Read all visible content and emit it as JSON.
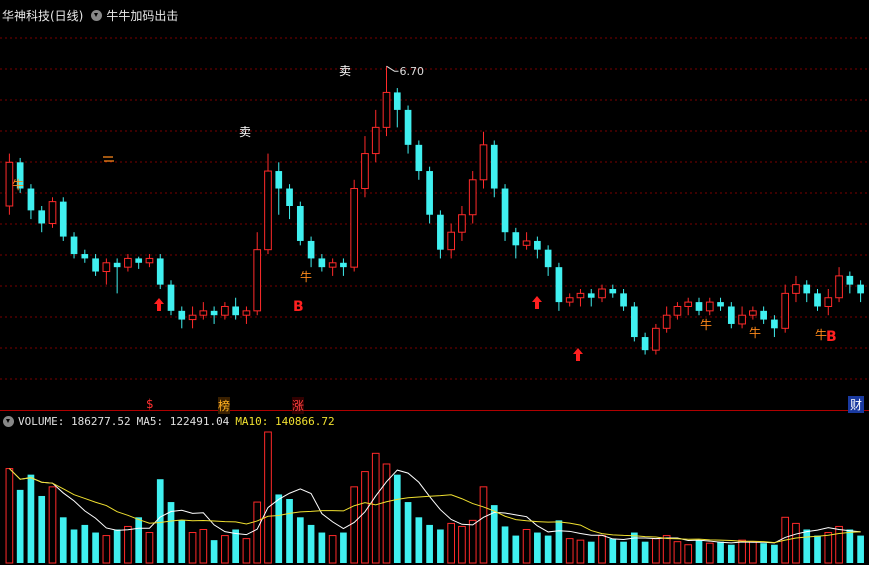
{
  "window": {
    "stock_name": "华神科技(日线)",
    "indicator_name": "牛牛加码出击"
  },
  "colors": {
    "up": "#ff2a2a",
    "down": "#40f0f0",
    "ma5": "#ffffff",
    "ma10": "#f0e030",
    "grid": "#7a0000",
    "background": "#000000",
    "buy_marker": "#ff2020"
  },
  "price_annotations": {
    "peak_value": "6.70",
    "sell_labels": [
      "卖",
      "卖"
    ],
    "bull_labels": [
      "牛",
      "牛",
      "牛",
      "牛",
      "牛"
    ],
    "buy_labels": [
      "B",
      "B"
    ],
    "arrow_up_icon": "up-arrow-icon"
  },
  "event_markers": {
    "dollar": "$",
    "board": "榜",
    "rise": "涨",
    "finance": "财"
  },
  "volume_panel": {
    "volume_label": "VOLUME: 186277.52",
    "ma5_label": "MA5: 122491.04",
    "ma10_label": "MA10: 140866.72"
  },
  "chart_data": {
    "type": "candlestick",
    "note_series": [
      {
        "name": "price",
        "ohlc": [
          [
            5.1,
            5.6,
            5.7,
            5.0
          ],
          [
            5.6,
            5.3,
            5.65,
            5.25
          ],
          [
            5.3,
            5.05,
            5.35,
            4.95
          ],
          [
            5.05,
            4.9,
            5.1,
            4.8
          ],
          [
            4.9,
            5.15,
            5.2,
            4.85
          ],
          [
            5.15,
            4.75,
            5.2,
            4.7
          ],
          [
            4.75,
            4.55,
            4.8,
            4.5
          ],
          [
            4.55,
            4.5,
            4.6,
            4.45
          ],
          [
            4.5,
            4.35,
            4.55,
            4.3
          ],
          [
            4.35,
            4.45,
            4.5,
            4.2
          ],
          [
            4.45,
            4.4,
            4.5,
            4.1
          ],
          [
            4.4,
            4.5,
            4.55,
            4.35
          ],
          [
            4.5,
            4.45,
            4.52,
            4.38
          ],
          [
            4.45,
            4.5,
            4.55,
            4.4
          ],
          [
            4.5,
            4.2,
            4.55,
            4.15
          ],
          [
            4.2,
            3.9,
            4.25,
            3.85
          ],
          [
            3.9,
            3.8,
            3.95,
            3.7
          ],
          [
            3.8,
            3.85,
            3.95,
            3.7
          ],
          [
            3.85,
            3.9,
            4.0,
            3.8
          ],
          [
            3.9,
            3.85,
            3.95,
            3.75
          ],
          [
            3.85,
            3.95,
            4.0,
            3.8
          ],
          [
            3.95,
            3.85,
            4.05,
            3.8
          ],
          [
            3.85,
            3.9,
            3.95,
            3.75
          ],
          [
            3.9,
            4.6,
            4.8,
            3.85
          ],
          [
            4.6,
            5.5,
            5.7,
            4.55
          ],
          [
            5.5,
            5.3,
            5.6,
            5.0
          ],
          [
            5.3,
            5.1,
            5.35,
            4.95
          ],
          [
            5.1,
            4.7,
            5.15,
            4.65
          ],
          [
            4.7,
            4.5,
            4.75,
            4.4
          ],
          [
            4.5,
            4.4,
            4.55,
            4.35
          ],
          [
            4.4,
            4.45,
            4.5,
            4.3
          ],
          [
            4.45,
            4.4,
            4.5,
            4.3
          ],
          [
            4.4,
            5.3,
            5.4,
            4.35
          ],
          [
            5.3,
            5.7,
            5.9,
            5.2
          ],
          [
            5.7,
            6.0,
            6.2,
            5.6
          ],
          [
            6.0,
            6.4,
            6.7,
            5.9
          ],
          [
            6.4,
            6.2,
            6.45,
            6.0
          ],
          [
            6.2,
            5.8,
            6.25,
            5.7
          ],
          [
            5.8,
            5.5,
            5.85,
            5.4
          ],
          [
            5.5,
            5.0,
            5.55,
            4.9
          ],
          [
            5.0,
            4.6,
            5.05,
            4.5
          ],
          [
            4.6,
            4.8,
            4.9,
            4.5
          ],
          [
            4.8,
            5.0,
            5.1,
            4.7
          ],
          [
            5.0,
            5.4,
            5.5,
            4.9
          ],
          [
            5.4,
            5.8,
            5.95,
            5.3
          ],
          [
            5.8,
            5.3,
            5.85,
            5.2
          ],
          [
            5.3,
            4.8,
            5.35,
            4.7
          ],
          [
            4.8,
            4.65,
            4.85,
            4.5
          ],
          [
            4.65,
            4.7,
            4.8,
            4.6
          ],
          [
            4.7,
            4.6,
            4.75,
            4.5
          ],
          [
            4.6,
            4.4,
            4.65,
            4.3
          ],
          [
            4.4,
            4.0,
            4.45,
            3.9
          ],
          [
            4.0,
            4.05,
            4.1,
            3.95
          ],
          [
            4.05,
            4.1,
            4.15,
            3.95
          ],
          [
            4.1,
            4.05,
            4.15,
            3.95
          ],
          [
            4.05,
            4.15,
            4.2,
            4.0
          ],
          [
            4.15,
            4.1,
            4.2,
            4.05
          ],
          [
            4.1,
            3.95,
            4.15,
            3.9
          ],
          [
            3.95,
            3.6,
            4.0,
            3.55
          ],
          [
            3.6,
            3.45,
            3.65,
            3.4
          ],
          [
            3.45,
            3.7,
            3.75,
            3.4
          ],
          [
            3.7,
            3.85,
            3.95,
            3.65
          ],
          [
            3.85,
            3.95,
            4.0,
            3.8
          ],
          [
            3.95,
            4.0,
            4.05,
            3.85
          ],
          [
            4.0,
            3.9,
            4.05,
            3.85
          ],
          [
            3.9,
            4.0,
            4.05,
            3.85
          ],
          [
            4.0,
            3.95,
            4.05,
            3.9
          ],
          [
            3.95,
            3.75,
            4.0,
            3.7
          ],
          [
            3.75,
            3.85,
            3.95,
            3.7
          ],
          [
            3.85,
            3.9,
            3.95,
            3.8
          ],
          [
            3.9,
            3.8,
            3.95,
            3.75
          ],
          [
            3.8,
            3.7,
            3.85,
            3.6
          ],
          [
            3.7,
            4.1,
            4.2,
            3.65
          ],
          [
            4.1,
            4.2,
            4.3,
            4.0
          ],
          [
            4.2,
            4.1,
            4.25,
            4.0
          ],
          [
            4.1,
            3.95,
            4.15,
            3.9
          ],
          [
            3.95,
            4.05,
            4.15,
            3.85
          ],
          [
            4.05,
            4.3,
            4.4,
            4.0
          ],
          [
            4.3,
            4.2,
            4.35,
            4.1
          ],
          [
            4.2,
            4.1,
            4.25,
            4.0
          ]
        ],
        "volume": [
          62,
          48,
          58,
          44,
          50,
          30,
          22,
          25,
          20,
          18,
          22,
          24,
          30,
          20,
          55,
          40,
          28,
          20,
          22,
          15,
          18,
          22,
          16,
          40,
          86,
          45,
          42,
          30,
          25,
          20,
          18,
          20,
          50,
          60,
          72,
          65,
          58,
          40,
          30,
          25,
          22,
          26,
          24,
          28,
          50,
          38,
          24,
          18,
          22,
          20,
          18,
          28,
          16,
          15,
          14,
          18,
          16,
          14,
          20,
          14,
          16,
          18,
          14,
          12,
          15,
          13,
          14,
          12,
          15,
          14,
          13,
          12,
          30,
          26,
          22,
          18,
          20,
          24,
          22,
          18
        ]
      }
    ],
    "ylim": [
      3.2,
      7.0
    ],
    "peak_label": "6.70"
  }
}
